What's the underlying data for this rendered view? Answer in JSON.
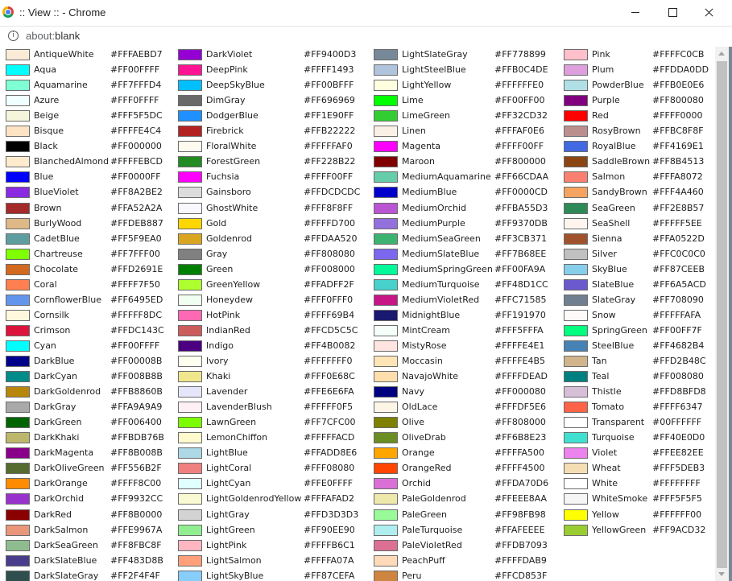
{
  "window": {
    "title": ":: View :: - Chrome",
    "url_scheme": "about:",
    "url_path": "blank"
  },
  "colors": [
    {
      "name": "AntiqueWhite",
      "hex": "#FFFAEBD7",
      "swatch": "#FAEBD7"
    },
    {
      "name": "Aqua",
      "hex": "#FF00FFFF",
      "swatch": "#00FFFF"
    },
    {
      "name": "Aquamarine",
      "hex": "#FF7FFFD4",
      "swatch": "#7FFFD4"
    },
    {
      "name": "Azure",
      "hex": "#FFF0FFFF",
      "swatch": "#F0FFFF"
    },
    {
      "name": "Beige",
      "hex": "#FFF5F5DC",
      "swatch": "#F5F5DC"
    },
    {
      "name": "Bisque",
      "hex": "#FFFFE4C4",
      "swatch": "#FFE4C4"
    },
    {
      "name": "Black",
      "hex": "#FF000000",
      "swatch": "#000000"
    },
    {
      "name": "BlanchedAlmond",
      "hex": "#FFFFEBCD",
      "swatch": "#FFEBCD"
    },
    {
      "name": "Blue",
      "hex": "#FF0000FF",
      "swatch": "#0000FF"
    },
    {
      "name": "BlueViolet",
      "hex": "#FF8A2BE2",
      "swatch": "#8A2BE2"
    },
    {
      "name": "Brown",
      "hex": "#FFA52A2A",
      "swatch": "#A52A2A"
    },
    {
      "name": "BurlyWood",
      "hex": "#FFDEB887",
      "swatch": "#DEB887"
    },
    {
      "name": "CadetBlue",
      "hex": "#FF5F9EA0",
      "swatch": "#5F9EA0"
    },
    {
      "name": "Chartreuse",
      "hex": "#FF7FFF00",
      "swatch": "#7FFF00"
    },
    {
      "name": "Chocolate",
      "hex": "#FFD2691E",
      "swatch": "#D2691E"
    },
    {
      "name": "Coral",
      "hex": "#FFFF7F50",
      "swatch": "#FF7F50"
    },
    {
      "name": "CornflowerBlue",
      "hex": "#FF6495ED",
      "swatch": "#6495ED"
    },
    {
      "name": "Cornsilk",
      "hex": "#FFFFF8DC",
      "swatch": "#FFF8DC"
    },
    {
      "name": "Crimson",
      "hex": "#FFDC143C",
      "swatch": "#DC143C"
    },
    {
      "name": "Cyan",
      "hex": "#FF00FFFF",
      "swatch": "#00FFFF"
    },
    {
      "name": "DarkBlue",
      "hex": "#FF00008B",
      "swatch": "#00008B"
    },
    {
      "name": "DarkCyan",
      "hex": "#FF008B8B",
      "swatch": "#008B8B"
    },
    {
      "name": "DarkGoldenrod",
      "hex": "#FFB8860B",
      "swatch": "#B8860B"
    },
    {
      "name": "DarkGray",
      "hex": "#FFA9A9A9",
      "swatch": "#A9A9A9"
    },
    {
      "name": "DarkGreen",
      "hex": "#FF006400",
      "swatch": "#006400"
    },
    {
      "name": "DarkKhaki",
      "hex": "#FFBDB76B",
      "swatch": "#BDB76B"
    },
    {
      "name": "DarkMagenta",
      "hex": "#FF8B008B",
      "swatch": "#8B008B"
    },
    {
      "name": "DarkOliveGreen",
      "hex": "#FF556B2F",
      "swatch": "#556B2F"
    },
    {
      "name": "DarkOrange",
      "hex": "#FFFF8C00",
      "swatch": "#FF8C00"
    },
    {
      "name": "DarkOrchid",
      "hex": "#FF9932CC",
      "swatch": "#9932CC"
    },
    {
      "name": "DarkRed",
      "hex": "#FF8B0000",
      "swatch": "#8B0000"
    },
    {
      "name": "DarkSalmon",
      "hex": "#FFE9967A",
      "swatch": "#E9967A"
    },
    {
      "name": "DarkSeaGreen",
      "hex": "#FF8FBC8F",
      "swatch": "#8FBC8F"
    },
    {
      "name": "DarkSlateBlue",
      "hex": "#FF483D8B",
      "swatch": "#483D8B"
    },
    {
      "name": "DarkSlateGray",
      "hex": "#FF2F4F4F",
      "swatch": "#2F4F4F"
    },
    {
      "name": "DarkViolet",
      "hex": "#FF9400D3",
      "swatch": "#9400D3"
    },
    {
      "name": "DeepPink",
      "hex": "#FFFF1493",
      "swatch": "#FF1493"
    },
    {
      "name": "DeepSkyBlue",
      "hex": "#FF00BFFF",
      "swatch": "#00BFFF"
    },
    {
      "name": "DimGray",
      "hex": "#FF696969",
      "swatch": "#696969"
    },
    {
      "name": "DodgerBlue",
      "hex": "#FF1E90FF",
      "swatch": "#1E90FF"
    },
    {
      "name": "Firebrick",
      "hex": "#FFB22222",
      "swatch": "#B22222"
    },
    {
      "name": "FloralWhite",
      "hex": "#FFFFFAF0",
      "swatch": "#FFFAF0"
    },
    {
      "name": "ForestGreen",
      "hex": "#FF228B22",
      "swatch": "#228B22"
    },
    {
      "name": "Fuchsia",
      "hex": "#FFFF00FF",
      "swatch": "#FF00FF"
    },
    {
      "name": "Gainsboro",
      "hex": "#FFDCDCDC",
      "swatch": "#DCDCDC"
    },
    {
      "name": "GhostWhite",
      "hex": "#FFF8F8FF",
      "swatch": "#F8F8FF"
    },
    {
      "name": "Gold",
      "hex": "#FFFFD700",
      "swatch": "#FFD700"
    },
    {
      "name": "Goldenrod",
      "hex": "#FFDAA520",
      "swatch": "#DAA520"
    },
    {
      "name": "Gray",
      "hex": "#FF808080",
      "swatch": "#808080"
    },
    {
      "name": "Green",
      "hex": "#FF008000",
      "swatch": "#008000"
    },
    {
      "name": "GreenYellow",
      "hex": "#FFADFF2F",
      "swatch": "#ADFF2F"
    },
    {
      "name": "Honeydew",
      "hex": "#FFF0FFF0",
      "swatch": "#F0FFF0"
    },
    {
      "name": "HotPink",
      "hex": "#FFFF69B4",
      "swatch": "#FF69B4"
    },
    {
      "name": "IndianRed",
      "hex": "#FFCD5C5C",
      "swatch": "#CD5C5C"
    },
    {
      "name": "Indigo",
      "hex": "#FF4B0082",
      "swatch": "#4B0082"
    },
    {
      "name": "Ivory",
      "hex": "#FFFFFFF0",
      "swatch": "#FFFFF0"
    },
    {
      "name": "Khaki",
      "hex": "#FFF0E68C",
      "swatch": "#F0E68C"
    },
    {
      "name": "Lavender",
      "hex": "#FFE6E6FA",
      "swatch": "#E6E6FA"
    },
    {
      "name": "LavenderBlush",
      "hex": "#FFFFF0F5",
      "swatch": "#FFF0F5"
    },
    {
      "name": "LawnGreen",
      "hex": "#FF7CFC00",
      "swatch": "#7CFC00"
    },
    {
      "name": "LemonChiffon",
      "hex": "#FFFFFACD",
      "swatch": "#FFFACD"
    },
    {
      "name": "LightBlue",
      "hex": "#FFADD8E6",
      "swatch": "#ADD8E6"
    },
    {
      "name": "LightCoral",
      "hex": "#FFF08080",
      "swatch": "#F08080"
    },
    {
      "name": "LightCyan",
      "hex": "#FFE0FFFF",
      "swatch": "#E0FFFF"
    },
    {
      "name": "LightGoldenrodYellow",
      "hex": "#FFFAFAD2",
      "swatch": "#FAFAD2"
    },
    {
      "name": "LightGray",
      "hex": "#FFD3D3D3",
      "swatch": "#D3D3D3"
    },
    {
      "name": "LightGreen",
      "hex": "#FF90EE90",
      "swatch": "#90EE90"
    },
    {
      "name": "LightPink",
      "hex": "#FFFFB6C1",
      "swatch": "#FFB6C1"
    },
    {
      "name": "LightSalmon",
      "hex": "#FFFFA07A",
      "swatch": "#FFA07A"
    },
    {
      "name": "LightSkyBlue",
      "hex": "#FF87CEFA",
      "swatch": "#87CEFA"
    },
    {
      "name": "LightSlateGray",
      "hex": "#FF778899",
      "swatch": "#778899"
    },
    {
      "name": "LightSteelBlue",
      "hex": "#FFB0C4DE",
      "swatch": "#B0C4DE"
    },
    {
      "name": "LightYellow",
      "hex": "#FFFFFFE0",
      "swatch": "#FFFFE0"
    },
    {
      "name": "Lime",
      "hex": "#FF00FF00",
      "swatch": "#00FF00"
    },
    {
      "name": "LimeGreen",
      "hex": "#FF32CD32",
      "swatch": "#32CD32"
    },
    {
      "name": "Linen",
      "hex": "#FFFAF0E6",
      "swatch": "#FAF0E6"
    },
    {
      "name": "Magenta",
      "hex": "#FFFF00FF",
      "swatch": "#FF00FF"
    },
    {
      "name": "Maroon",
      "hex": "#FF800000",
      "swatch": "#800000"
    },
    {
      "name": "MediumAquamarine",
      "hex": "#FF66CDAA",
      "swatch": "#66CDAA"
    },
    {
      "name": "MediumBlue",
      "hex": "#FF0000CD",
      "swatch": "#0000CD"
    },
    {
      "name": "MediumOrchid",
      "hex": "#FFBA55D3",
      "swatch": "#BA55D3"
    },
    {
      "name": "MediumPurple",
      "hex": "#FF9370DB",
      "swatch": "#9370DB"
    },
    {
      "name": "MediumSeaGreen",
      "hex": "#FF3CB371",
      "swatch": "#3CB371"
    },
    {
      "name": "MediumSlateBlue",
      "hex": "#FF7B68EE",
      "swatch": "#7B68EE"
    },
    {
      "name": "MediumSpringGreen",
      "hex": "#FF00FA9A",
      "swatch": "#00FA9A"
    },
    {
      "name": "MediumTurquoise",
      "hex": "#FF48D1CC",
      "swatch": "#48D1CC"
    },
    {
      "name": "MediumVioletRed",
      "hex": "#FFC71585",
      "swatch": "#C71585"
    },
    {
      "name": "MidnightBlue",
      "hex": "#FF191970",
      "swatch": "#191970"
    },
    {
      "name": "MintCream",
      "hex": "#FFF5FFFA",
      "swatch": "#F5FFFA"
    },
    {
      "name": "MistyRose",
      "hex": "#FFFFE4E1",
      "swatch": "#FFE4E1"
    },
    {
      "name": "Moccasin",
      "hex": "#FFFFE4B5",
      "swatch": "#FFE4B5"
    },
    {
      "name": "NavajoWhite",
      "hex": "#FFFFDEAD",
      "swatch": "#FFDEAD"
    },
    {
      "name": "Navy",
      "hex": "#FF000080",
      "swatch": "#000080"
    },
    {
      "name": "OldLace",
      "hex": "#FFFDF5E6",
      "swatch": "#FDF5E6"
    },
    {
      "name": "Olive",
      "hex": "#FF808000",
      "swatch": "#808000"
    },
    {
      "name": "OliveDrab",
      "hex": "#FF6B8E23",
      "swatch": "#6B8E23"
    },
    {
      "name": "Orange",
      "hex": "#FFFFA500",
      "swatch": "#FFA500"
    },
    {
      "name": "OrangeRed",
      "hex": "#FFFF4500",
      "swatch": "#FF4500"
    },
    {
      "name": "Orchid",
      "hex": "#FFDA70D6",
      "swatch": "#DA70D6"
    },
    {
      "name": "PaleGoldenrod",
      "hex": "#FFEEE8AA",
      "swatch": "#EEE8AA"
    },
    {
      "name": "PaleGreen",
      "hex": "#FF98FB98",
      "swatch": "#98FB98"
    },
    {
      "name": "PaleTurquoise",
      "hex": "#FFAFEEEE",
      "swatch": "#AFEEEE"
    },
    {
      "name": "PaleVioletRed",
      "hex": "#FFDB7093",
      "swatch": "#DB7093"
    },
    {
      "name": "PeachPuff",
      "hex": "#FFFFDAB9",
      "swatch": "#FFDAB9"
    },
    {
      "name": "Peru",
      "hex": "#FFCD853F",
      "swatch": "#CD853F"
    },
    {
      "name": "Pink",
      "hex": "#FFFFC0CB",
      "swatch": "#FFC0CB"
    },
    {
      "name": "Plum",
      "hex": "#FFDDA0DD",
      "swatch": "#DDA0DD"
    },
    {
      "name": "PowderBlue",
      "hex": "#FFB0E0E6",
      "swatch": "#B0E0E6"
    },
    {
      "name": "Purple",
      "hex": "#FF800080",
      "swatch": "#800080"
    },
    {
      "name": "Red",
      "hex": "#FFFF0000",
      "swatch": "#FF0000"
    },
    {
      "name": "RosyBrown",
      "hex": "#FFBC8F8F",
      "swatch": "#BC8F8F"
    },
    {
      "name": "RoyalBlue",
      "hex": "#FF4169E1",
      "swatch": "#4169E1"
    },
    {
      "name": "SaddleBrown",
      "hex": "#FF8B4513",
      "swatch": "#8B4513"
    },
    {
      "name": "Salmon",
      "hex": "#FFFA8072",
      "swatch": "#FA8072"
    },
    {
      "name": "SandyBrown",
      "hex": "#FFF4A460",
      "swatch": "#F4A460"
    },
    {
      "name": "SeaGreen",
      "hex": "#FF2E8B57",
      "swatch": "#2E8B57"
    },
    {
      "name": "SeaShell",
      "hex": "#FFFFF5EE",
      "swatch": "#FFF5EE"
    },
    {
      "name": "Sienna",
      "hex": "#FFA0522D",
      "swatch": "#A0522D"
    },
    {
      "name": "Silver",
      "hex": "#FFC0C0C0",
      "swatch": "#C0C0C0"
    },
    {
      "name": "SkyBlue",
      "hex": "#FF87CEEB",
      "swatch": "#87CEEB"
    },
    {
      "name": "SlateBlue",
      "hex": "#FF6A5ACD",
      "swatch": "#6A5ACD"
    },
    {
      "name": "SlateGray",
      "hex": "#FF708090",
      "swatch": "#708090"
    },
    {
      "name": "Snow",
      "hex": "#FFFFFAFA",
      "swatch": "#FFFAFA"
    },
    {
      "name": "SpringGreen",
      "hex": "#FF00FF7F",
      "swatch": "#00FF7F"
    },
    {
      "name": "SteelBlue",
      "hex": "#FF4682B4",
      "swatch": "#4682B4"
    },
    {
      "name": "Tan",
      "hex": "#FFD2B48C",
      "swatch": "#D2B48C"
    },
    {
      "name": "Teal",
      "hex": "#FF008080",
      "swatch": "#008080"
    },
    {
      "name": "Thistle",
      "hex": "#FFD8BFD8",
      "swatch": "#D8BFD8"
    },
    {
      "name": "Tomato",
      "hex": "#FFFF6347",
      "swatch": "#FF6347"
    },
    {
      "name": "Transparent",
      "hex": "#00FFFFFF",
      "swatch": "#FFFFFF"
    },
    {
      "name": "Turquoise",
      "hex": "#FF40E0D0",
      "swatch": "#40E0D0"
    },
    {
      "name": "Violet",
      "hex": "#FFEE82EE",
      "swatch": "#EE82EE"
    },
    {
      "name": "Wheat",
      "hex": "#FFF5DEB3",
      "swatch": "#F5DEB3"
    },
    {
      "name": "White",
      "hex": "#FFFFFFFF",
      "swatch": "#FFFFFF"
    },
    {
      "name": "WhiteSmoke",
      "hex": "#FFF5F5F5",
      "swatch": "#F5F5F5"
    },
    {
      "name": "Yellow",
      "hex": "#FFFFFF00",
      "swatch": "#FFFF00"
    },
    {
      "name": "YellowGreen",
      "hex": "#FF9ACD32",
      "swatch": "#9ACD32"
    }
  ]
}
